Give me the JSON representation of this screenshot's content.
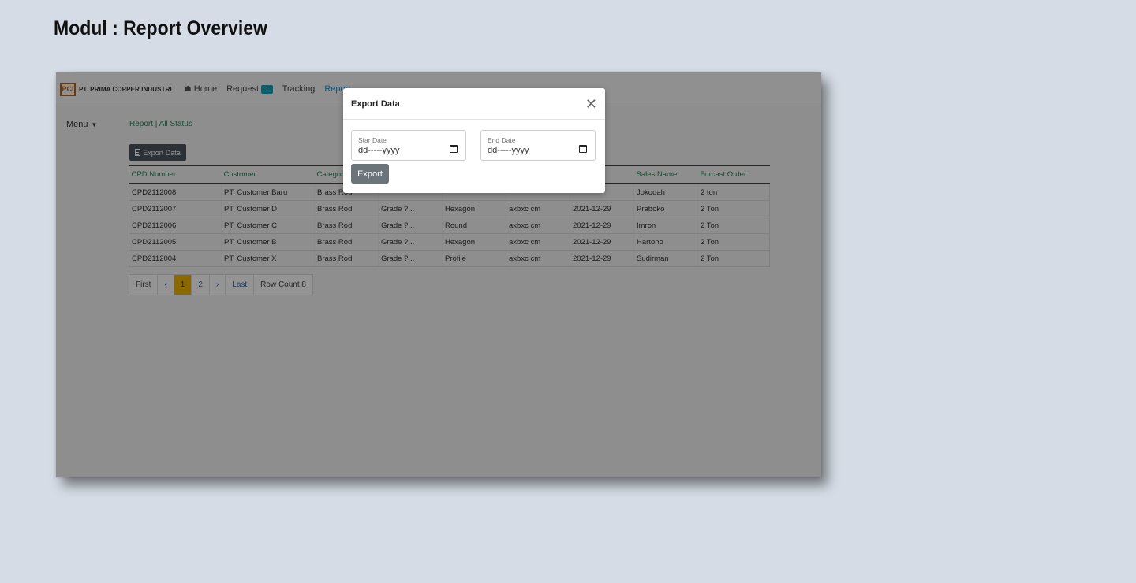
{
  "page": {
    "heading": "Modul : Report Overview"
  },
  "navbar": {
    "logo_text": "PCI",
    "brand": "PT. PRIMA COPPER INDUSTRI",
    "home": "Home",
    "request": "Request",
    "request_badge": "1",
    "tracking": "Tracking",
    "report": "Report"
  },
  "menu": {
    "label": "Menu"
  },
  "breadcrumb": "Report | All Status",
  "toolbar": {
    "export_data_label": "Export Data"
  },
  "table": {
    "headers": [
      "CPD Number",
      "Customer",
      "Category",
      "",
      "",
      "",
      "",
      "Sales Name",
      "Forcast Order"
    ],
    "rows": [
      [
        "CPD2112008",
        "PT. Customer Baru",
        "Brass Rod",
        "",
        "",
        "",
        "",
        "Jokodah",
        "2 ton"
      ],
      [
        "CPD2112007",
        "PT. Customer D",
        "Brass Rod",
        "Grade ?...",
        "Hexagon",
        "axbxc cm",
        "2021-12-29",
        "Praboko",
        "2 Ton"
      ],
      [
        "CPD2112006",
        "PT. Customer C",
        "Brass Rod",
        "Grade ?...",
        "Round",
        "axbxc cm",
        "2021-12-29",
        "Imron",
        "2 Ton"
      ],
      [
        "CPD2112005",
        "PT. Customer B",
        "Brass Rod",
        "Grade ?...",
        "Hexagon",
        "axbxc cm",
        "2021-12-29",
        "Hartono",
        "2 Ton"
      ],
      [
        "CPD2112004",
        "PT. Customer X",
        "Brass Rod",
        "Grade ?...",
        "Profile",
        "axbxc cm",
        "2021-12-29",
        "Sudirman",
        "2 Ton"
      ]
    ]
  },
  "pagination": {
    "first": "First",
    "prev": "‹",
    "pages": [
      "1",
      "2"
    ],
    "current_page": "1",
    "next": "›",
    "last": "Last",
    "row_count": "Row Count 8"
  },
  "modal": {
    "title": "Export Data",
    "start_label": "Star Date",
    "start_value": "dd-----yyyy",
    "end_label": "End Date",
    "end_value": "dd-----yyyy",
    "export_label": "Export"
  },
  "colors": {
    "page_bg": "#d5dce5",
    "accent_green": "#1a8e55",
    "link_blue": "#1c8ec9",
    "badge": "#17a2b8",
    "current_page": "#f0b400",
    "export_button": "#4b555f"
  },
  "icons": [
    "home-icon",
    "file-icon",
    "caret-down-icon",
    "close-icon",
    "calendar-icon",
    "chevron-left-icon",
    "chevron-right-icon"
  ]
}
